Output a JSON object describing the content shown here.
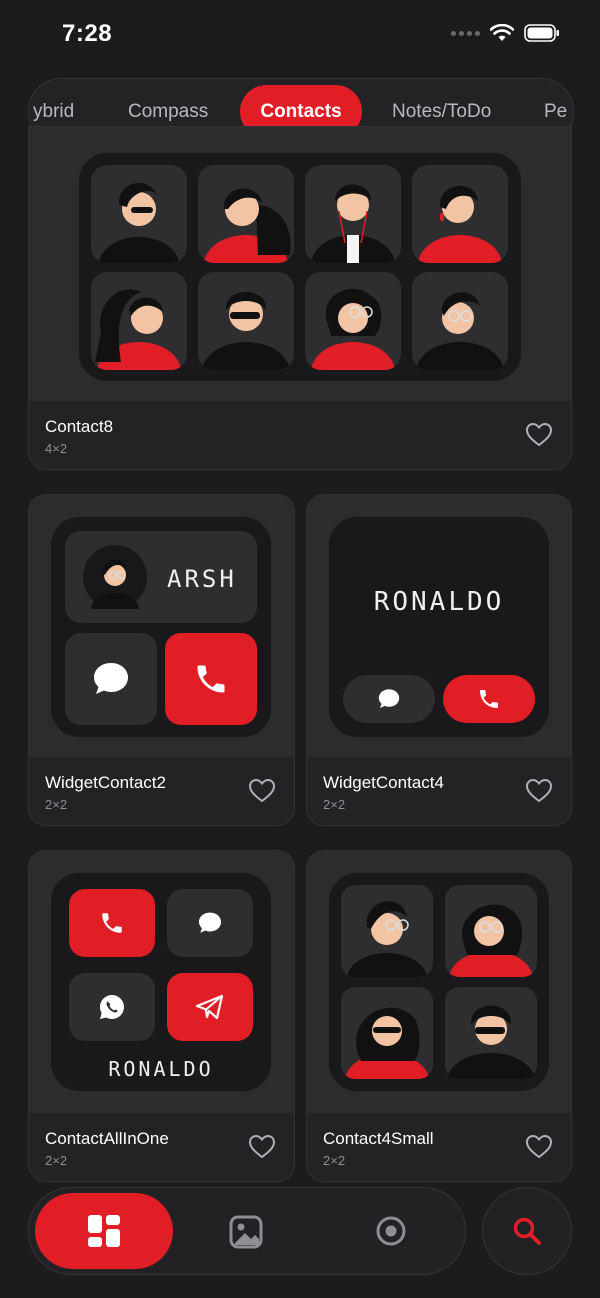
{
  "status": {
    "time": "7:28"
  },
  "tabs": {
    "items": [
      "ybrid",
      "Compass",
      "Contacts",
      "Notes/ToDo",
      "Pe"
    ],
    "active": "Contacts"
  },
  "cards": [
    {
      "title": "Contact8",
      "size": "4×2"
    },
    {
      "title": "WidgetContact2",
      "size": "2×2",
      "name_label": "ARSH"
    },
    {
      "title": "WidgetContact4",
      "size": "2×2",
      "name_label": "RONALDO"
    },
    {
      "title": "ContactAllInOne",
      "size": "2×2",
      "name_label": "RONALDO"
    },
    {
      "title": "Contact4Small",
      "size": "2×2"
    }
  ],
  "icons": {
    "nav_widgets": "grid-icon",
    "nav_wallpaper": "image-icon",
    "nav_record": "record-icon",
    "search": "search-icon",
    "favorite": "heart-icon"
  },
  "colors": {
    "accent": "#e11e26",
    "background": "#1c1c1e",
    "card": "#2c2c2f"
  }
}
